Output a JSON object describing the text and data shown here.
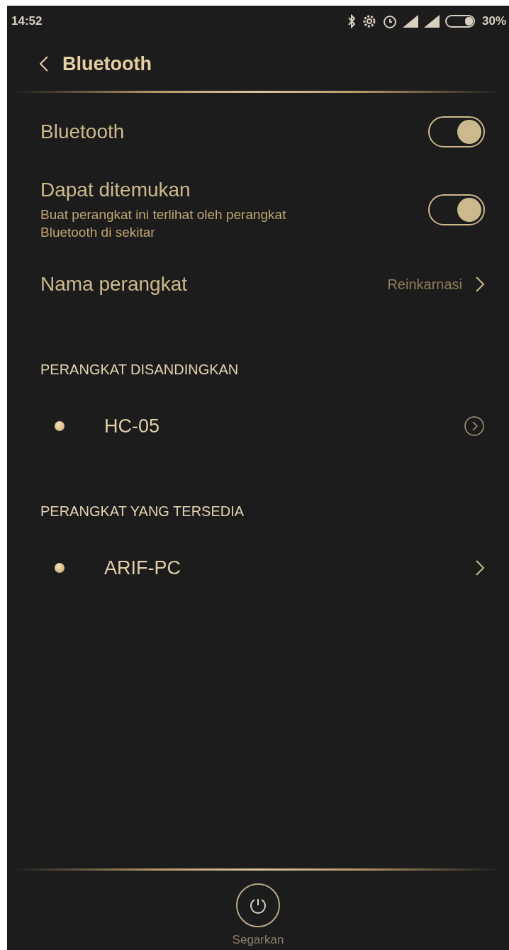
{
  "status_bar": {
    "time": "14:52",
    "battery": "30%"
  },
  "header": {
    "title": "Bluetooth"
  },
  "settings": [
    {
      "label": "Bluetooth",
      "on": true
    },
    {
      "label": "Dapat ditemukan",
      "description": "Buat perangkat ini terlihat oleh perangkat Bluetooth di sekitar",
      "on": true
    }
  ],
  "device_name": {
    "label": "Nama perangkat",
    "value": "Reinkarnasi"
  },
  "sections": [
    {
      "title": "PERANGKAT DISANDINGKAN",
      "devices": [
        {
          "name": "HC-05",
          "kind": "paired"
        }
      ]
    },
    {
      "title": "PERANGKAT YANG TERSEDIA",
      "devices": [
        {
          "name": "ARIF-PC",
          "kind": "available"
        }
      ]
    }
  ],
  "bottom_action": {
    "label": "Segarkan"
  }
}
